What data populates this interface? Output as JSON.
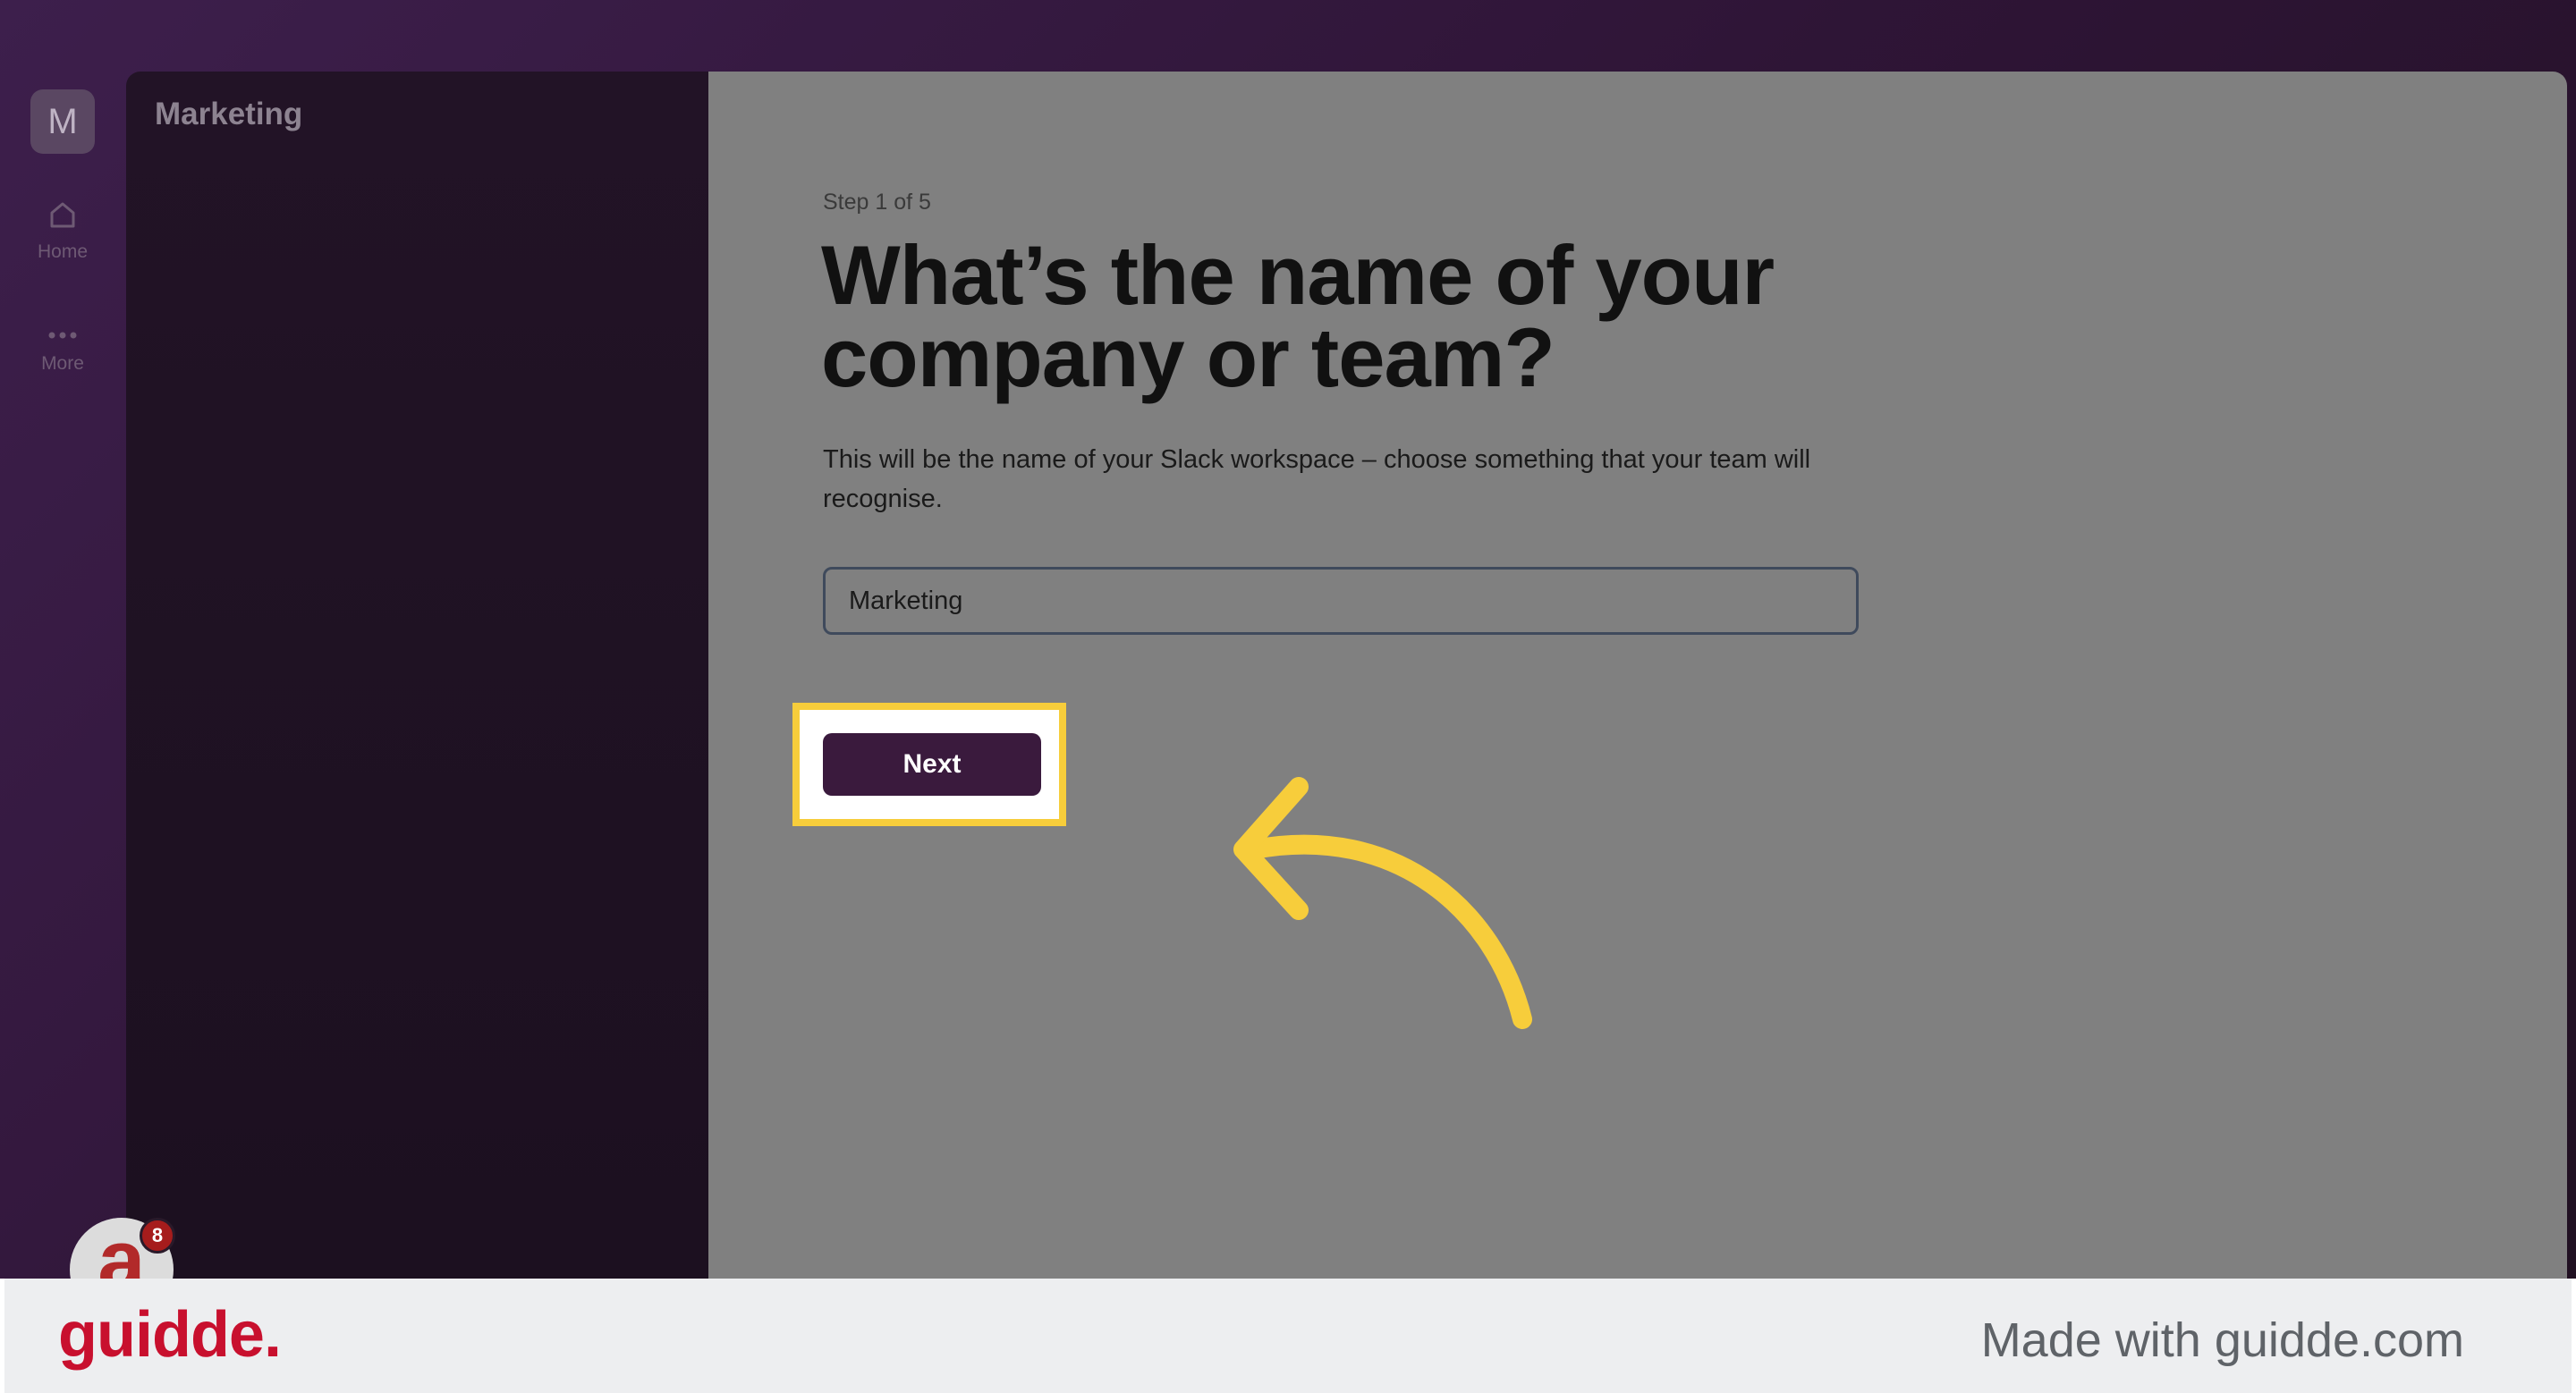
{
  "rail": {
    "workspace_initial": "M",
    "home_label": "Home",
    "more_label": "More",
    "icons": [
      "home-icon",
      "more-dots-icon"
    ]
  },
  "sidebar": {
    "title": "Marketing"
  },
  "main": {
    "step": "Step 1 of 5",
    "headline": "What’s the name of your company or team?",
    "description": "This will be the name of your Slack workspace – choose something that your team will recognise.",
    "input_value": "Marketing",
    "next_label": "Next"
  },
  "avatar": {
    "badge_count": "8"
  },
  "footer": {
    "brand": "guidde.",
    "made_with": "Made with guidde.com"
  },
  "colors": {
    "highlight": "#f7cd3b",
    "button": "#3a1a3d",
    "brand": "#c8102e",
    "arrow": "#f7cd3b"
  }
}
